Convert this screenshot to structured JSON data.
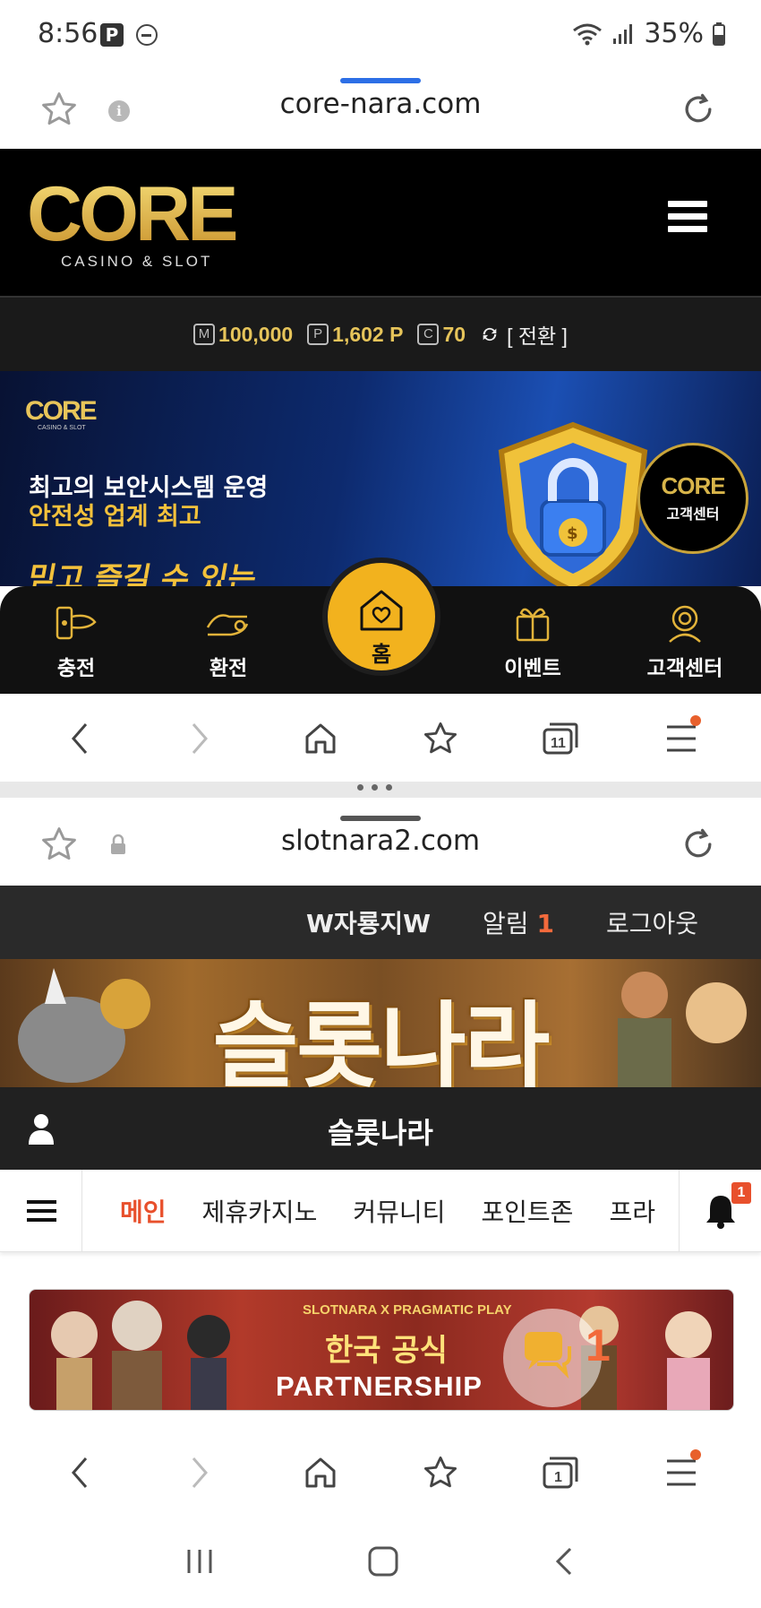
{
  "status_bar": {
    "time": "8:56",
    "p_icon": "P",
    "battery": "35%"
  },
  "top_browser": {
    "url": "core-nara.com",
    "grab_color": "#2d6fe6",
    "logo_text": "CORE",
    "logo_sub": "CASINO & SLOT",
    "balances": [
      {
        "icon": "M",
        "value": "100,000"
      },
      {
        "icon": "P",
        "value": "1,602 P"
      },
      {
        "icon": "C",
        "value": "70"
      }
    ],
    "switch_label": "[ 전환 ]",
    "banner": {
      "line1": "최고의 보안시스템 운영",
      "line2": "안전성 업계 최고",
      "line3": "믿고 즐길 수 있는",
      "badge_logo": "CORE",
      "badge_sub": "고객센터"
    },
    "nav": [
      {
        "label": "충전",
        "icon": "charge-icon"
      },
      {
        "label": "환전",
        "icon": "exchange-icon"
      },
      {
        "label": "홈",
        "icon": "home-heart-icon"
      },
      {
        "label": "이벤트",
        "icon": "gift-icon"
      },
      {
        "label": "고객센터",
        "icon": "support-icon"
      }
    ],
    "tab_count": "11"
  },
  "bottom_browser": {
    "url": "slotnara2.com",
    "user": "W자룡지W",
    "alarm_label": "알림",
    "alarm_count": "1",
    "logout_label": "로그아웃",
    "banner_title": "슬롯나라",
    "site_title": "슬롯나라",
    "tabs": [
      "메인",
      "제휴카지노",
      "커뮤니티",
      "포인트존",
      "프라"
    ],
    "bell_badge": "1",
    "partner_banner": {
      "logo": "SLOTNARA X PRAGMATIC PLAY",
      "kr": "한국 공식",
      "en": "PARTNERSHIP"
    },
    "chat_count": "1",
    "tab_count": "1"
  },
  "colors": {
    "accent": "#e8502c",
    "gold": "#f2b21e",
    "nav_dot": "#e8602c"
  }
}
